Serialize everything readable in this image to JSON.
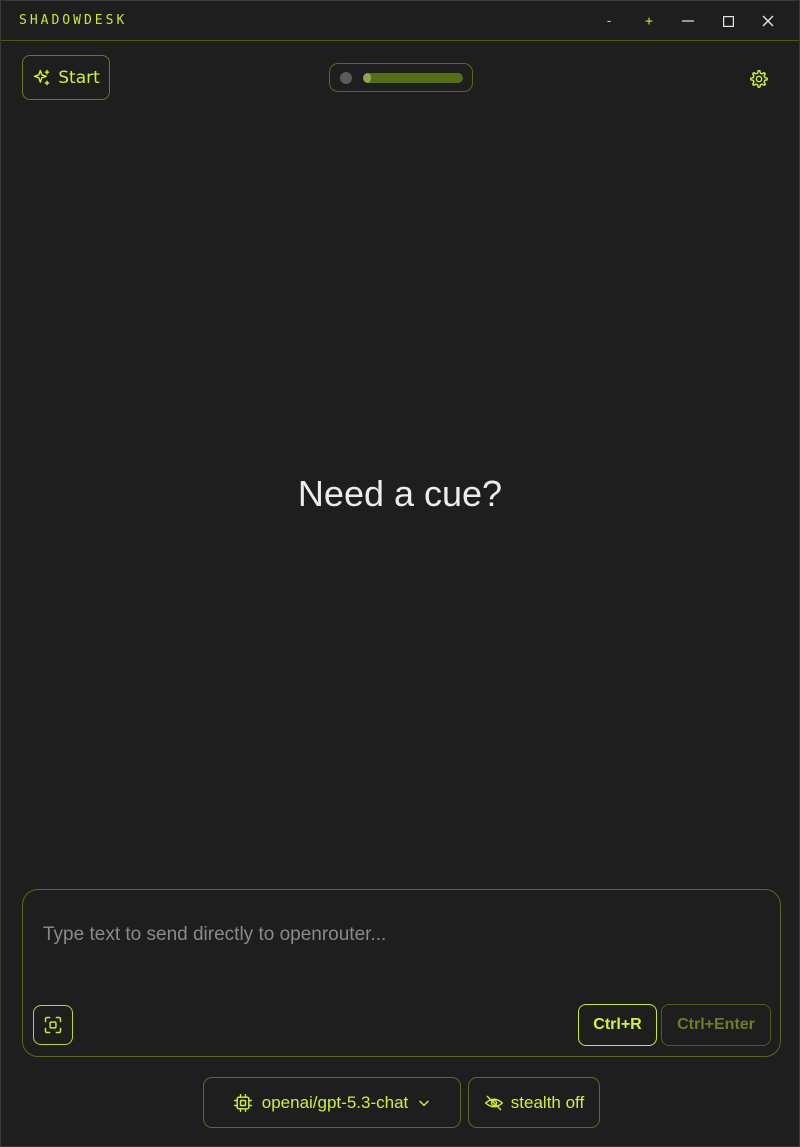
{
  "window": {
    "title": "SHADOWDESK",
    "controls": {
      "zoom_out_label": "-",
      "zoom_in_label": "+"
    }
  },
  "toolbar": {
    "start_label": "Start",
    "audio_level": 0.06
  },
  "main": {
    "prompt": "Need a cue?"
  },
  "compose": {
    "placeholder": "Type text to send directly to openrouter...",
    "value": "",
    "shortcut_primary": "Ctrl+R",
    "shortcut_secondary": "Ctrl+Enter"
  },
  "footer": {
    "model_label": "openai/gpt-5.3-chat",
    "stealth_label": "stealth off"
  },
  "icons": {
    "start": "sparkles-icon",
    "settings": "gear-icon",
    "capture": "screen-capture-icon",
    "model": "cpu-chip-icon",
    "model_dropdown": "chevron-down-icon",
    "stealth": "eye-off-icon"
  },
  "colors": {
    "accent": "#c6ea2b",
    "background": "#1e1e1e",
    "border": "#59681a",
    "muted_accent": "#6d7f1e"
  }
}
